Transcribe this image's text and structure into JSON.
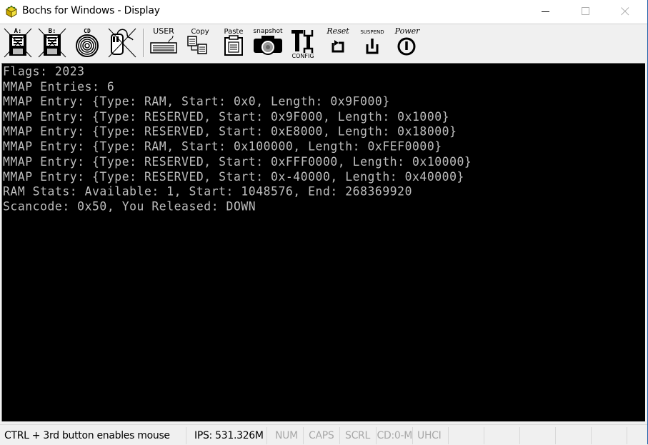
{
  "window": {
    "title": "Bochs for Windows - Display",
    "controls": {
      "minimize": "minimize",
      "maximize": "maximize",
      "close": "close"
    }
  },
  "toolbar": {
    "buttons": [
      {
        "id": "floppy-a",
        "label": "A:",
        "icon": "floppy-disk-icon",
        "disabled": true
      },
      {
        "id": "floppy-b",
        "label": "B:",
        "icon": "floppy-disk-icon",
        "disabled": true
      },
      {
        "id": "cdrom",
        "label": "CD",
        "icon": "cd-icon"
      },
      {
        "id": "mouse",
        "label": "",
        "icon": "mouse-icon",
        "disabled": true
      },
      {
        "id": "user",
        "label": "USER",
        "icon": "keyboard-icon"
      },
      {
        "id": "copy",
        "label": "Copy",
        "icon": "copy-icon"
      },
      {
        "id": "paste",
        "label": "Paste",
        "icon": "paste-icon"
      },
      {
        "id": "snapshot",
        "label": "snapshot",
        "icon": "camera-icon"
      },
      {
        "id": "config",
        "label": "CONFIG",
        "icon": "config-icon"
      },
      {
        "id": "reset",
        "label": "Reset",
        "icon": "reset-icon"
      },
      {
        "id": "suspend",
        "label": "SUSPEND",
        "icon": "suspend-icon"
      },
      {
        "id": "power",
        "label": "Power",
        "icon": "power-icon"
      }
    ]
  },
  "console": {
    "lines": [
      "Flags: 2023",
      "MMAP Entries: 6",
      "MMAP Entry: {Type: RAM, Start: 0x0, Length: 0x9F000}",
      "MMAP Entry: {Type: RESERVED, Start: 0x9F000, Length: 0x1000}",
      "MMAP Entry: {Type: RESERVED, Start: 0xE8000, Length: 0x18000}",
      "MMAP Entry: {Type: RAM, Start: 0x100000, Length: 0xFEF0000}",
      "MMAP Entry: {Type: RESERVED, Start: 0xFFF0000, Length: 0x10000}",
      "MMAP Entry: {Type: RESERVED, Start: 0x-40000, Length: 0x40000}",
      "RAM Stats: Available: 1, Start: 1048576, End: 268369920",
      "Scancode: 0x50, You Released: DOWN"
    ]
  },
  "statusbar": {
    "mouse_hint": "CTRL + 3rd button enables mouse",
    "ips": "IPS: 531.326M",
    "num": "NUM",
    "caps": "CAPS",
    "scrl": "SCRL",
    "cd": "CD:0-M",
    "uhci": "UHCI",
    "empty": [
      "",
      "",
      "",
      "",
      "",
      ""
    ]
  }
}
